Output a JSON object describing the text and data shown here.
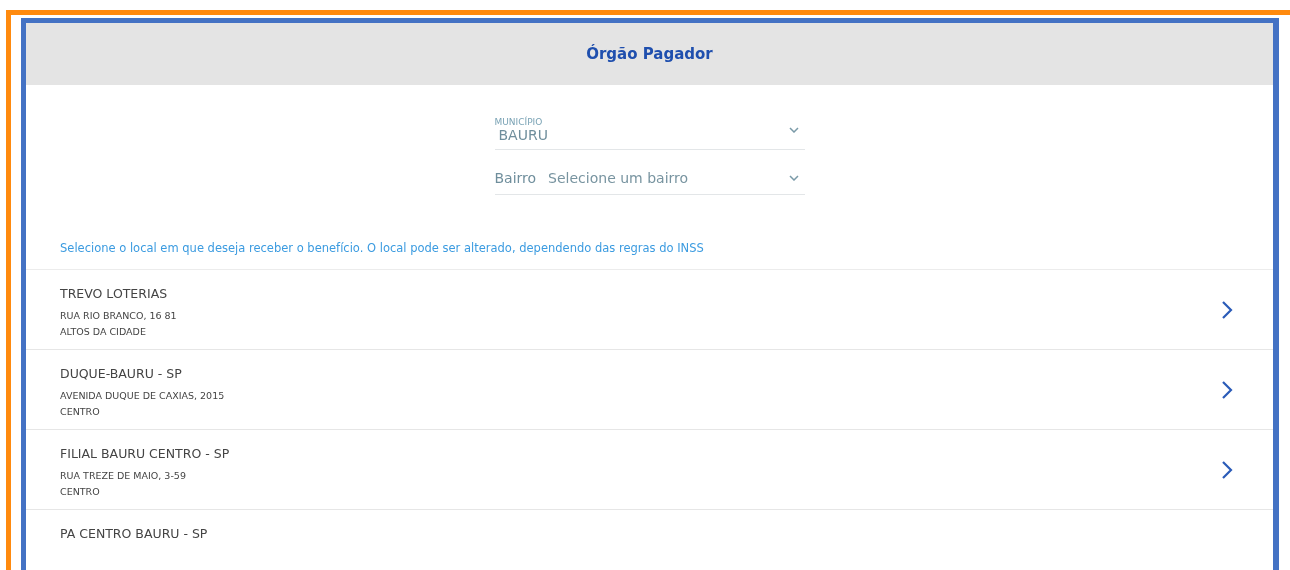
{
  "header": {
    "title": "Órgão Pagador"
  },
  "municipio": {
    "label": "MUNICÍPIO",
    "value": "BAURU"
  },
  "bairro": {
    "label": "Bairro",
    "placeholder": "Selecione um bairro"
  },
  "instruction": "Selecione o local em que deseja receber o benefício. O local pode ser alterado, dependendo das regras do INSS",
  "locations": [
    {
      "name": "TREVO LOTERIAS",
      "address": "RUA RIO BRANCO, 16 81",
      "district": "ALTOS DA CIDADE"
    },
    {
      "name": "DUQUE-BAURU - SP",
      "address": "AVENIDA DUQUE DE CAXIAS, 2015",
      "district": "CENTRO"
    },
    {
      "name": "FILIAL BAURU CENTRO - SP",
      "address": "RUA TREZE DE MAIO, 3-59",
      "district": "CENTRO"
    },
    {
      "name": "PA CENTRO BAURU - SP"
    }
  ]
}
